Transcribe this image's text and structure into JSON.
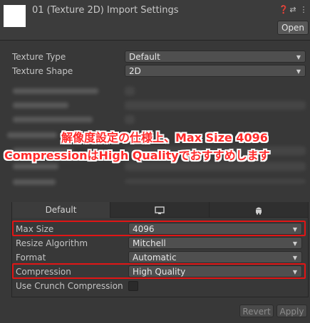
{
  "header": {
    "title": "01 (Texture 2D) Import Settings",
    "open_label": "Open",
    "icons": [
      "help-icon",
      "preset-icon",
      "menu-icon"
    ]
  },
  "texture_type": {
    "label": "Texture Type",
    "value": "Default"
  },
  "texture_shape": {
    "label": "Texture Shape",
    "value": "2D"
  },
  "annotation": {
    "line1": "解像度設定の仕様上、Max Size 4096",
    "line2": "CompressionはHigh Qualityでおすすめします"
  },
  "platform_tabs": {
    "default_label": "Default",
    "icons": [
      "monitor-icon",
      "android-icon"
    ]
  },
  "settings": {
    "max_size": {
      "label": "Max Size",
      "value": "4096"
    },
    "resize_algorithm": {
      "label": "Resize Algorithm",
      "value": "Mitchell"
    },
    "format": {
      "label": "Format",
      "value": "Automatic"
    },
    "compression": {
      "label": "Compression",
      "value": "High Quality"
    },
    "crunch": {
      "label": "Use Crunch Compression",
      "checked": false
    }
  },
  "footer": {
    "revert_label": "Revert",
    "apply_label": "Apply"
  },
  "colors": {
    "highlight": "#e11515",
    "annotation_text": "#ff2a2a",
    "background": "#383838"
  }
}
